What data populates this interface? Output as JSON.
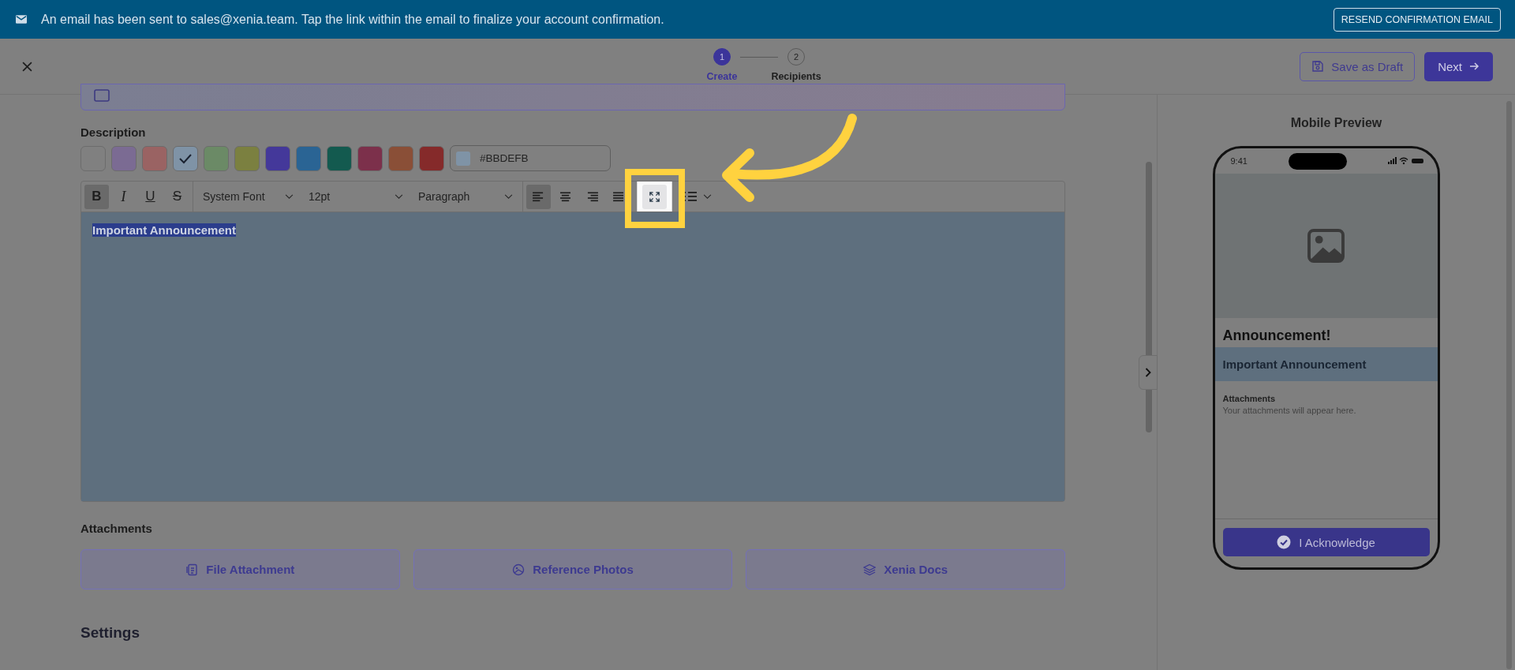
{
  "banner": {
    "message": "An email has been sent to sales@xenia.team. Tap the link within the email to finalize your account confirmation.",
    "button": "RESEND CONFIRMATION EMAIL"
  },
  "header": {
    "steps": [
      {
        "number": "1",
        "label": "Create",
        "selected": true
      },
      {
        "number": "2",
        "label": "Recipients",
        "selected": false
      }
    ],
    "save_button": "Save as Draft",
    "next_button": "Next"
  },
  "description": {
    "label": "Description",
    "swatches": [
      {
        "color": "#808080",
        "selected": false
      },
      {
        "color": "#7b6b93",
        "selected": false
      },
      {
        "color": "#9a6363",
        "selected": false
      },
      {
        "color": "#7f93a6",
        "selected": true
      },
      {
        "color": "#6b8a66",
        "selected": false
      },
      {
        "color": "#7b8040",
        "selected": false
      },
      {
        "color": "#44389a",
        "selected": false
      },
      {
        "color": "#2a6494",
        "selected": false
      },
      {
        "color": "#135a4f",
        "selected": false
      },
      {
        "color": "#7c304b",
        "selected": false
      },
      {
        "color": "#8a4f37",
        "selected": false
      },
      {
        "color": "#852a2a",
        "selected": false
      }
    ],
    "hex_value": "#BBDEFB",
    "toolbar": {
      "formats": [
        {
          "kind": "bold",
          "label": "B",
          "selected": true
        },
        {
          "kind": "italic",
          "label": "I",
          "selected": false
        },
        {
          "kind": "underline",
          "label": "U",
          "selected": false
        },
        {
          "kind": "strike",
          "label": "S",
          "selected": false
        }
      ],
      "selects": [
        "System Font",
        "12pt",
        "Paragraph"
      ],
      "aligns": [
        {
          "kind": "left",
          "selected": true
        },
        {
          "kind": "center",
          "selected": false
        },
        {
          "kind": "right",
          "selected": false
        },
        {
          "kind": "justify",
          "selected": false
        }
      ]
    },
    "editor_text": "Important Announcement"
  },
  "attachments": {
    "label": "Attachments",
    "buttons": [
      {
        "kind": "file",
        "label": "File Attachment"
      },
      {
        "kind": "photo",
        "label": "Reference Photos"
      },
      {
        "kind": "docs",
        "label": "Xenia Docs"
      }
    ]
  },
  "settings_heading": "Settings",
  "preview": {
    "title": "Mobile Preview",
    "time": "9:41",
    "heading": "Announcement!",
    "body": "Important Announcement",
    "attachments_label": "Attachments",
    "attachments_hint": "Your attachments will appear here.",
    "button": "I Acknowledge"
  }
}
